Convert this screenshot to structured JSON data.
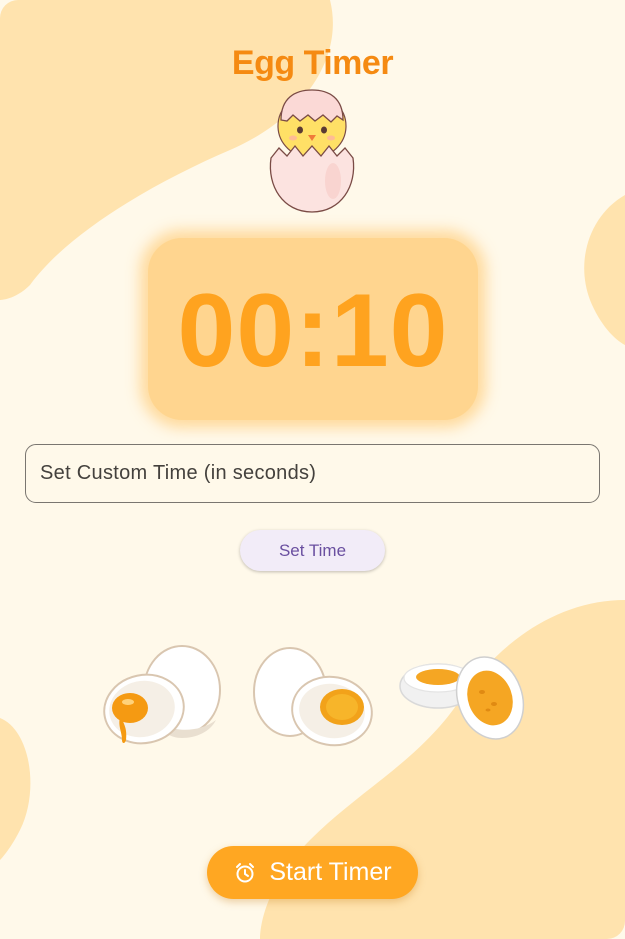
{
  "app": {
    "title": "Egg Timer"
  },
  "timer": {
    "display": "00:10"
  },
  "custom_time": {
    "placeholder": "Set Custom Time (in seconds)",
    "value": ""
  },
  "buttons": {
    "set_time_label": "Set Time",
    "start_label": "Start Timer",
    "start_icon": "alarm-clock-icon"
  },
  "egg_options": [
    {
      "icon": "soft-boiled-egg-icon"
    },
    {
      "icon": "medium-boiled-egg-icon"
    },
    {
      "icon": "hard-boiled-egg-icon"
    }
  ],
  "colors": {
    "background": "#fff9ea",
    "blob": "#ffe3ae",
    "accent": "#ffa722",
    "title": "#f58a12",
    "timer_card": "#ffd58f",
    "timer_text": "#ffa31f"
  }
}
